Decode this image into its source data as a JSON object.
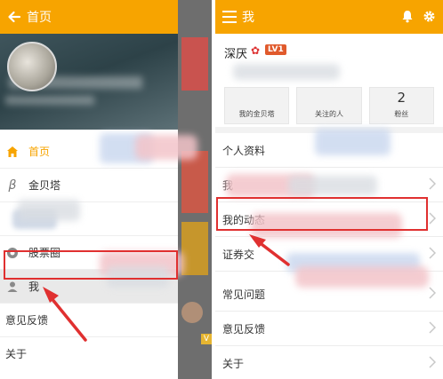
{
  "left_screen": {
    "topbar": {
      "title": "首页"
    },
    "drawer_menu": [
      {
        "label": "首页",
        "icon": "home-icon",
        "active": true
      },
      {
        "label": "金贝塔",
        "icon": "beta-icon"
      },
      {
        "label": "",
        "icon": ""
      },
      {
        "label": "股票圈",
        "icon": "circle-icon"
      },
      {
        "label": "我",
        "icon": "person-icon",
        "selected": true
      },
      {
        "label": "意见反馈",
        "icon": ""
      },
      {
        "label": "关于",
        "icon": ""
      }
    ],
    "underlay_badge": "V"
  },
  "right_screen": {
    "topbar": {
      "title": "我"
    },
    "user": {
      "name": "深厌",
      "level_badge": "LV1"
    },
    "stats": [
      {
        "value": "",
        "label": "我的金贝塔"
      },
      {
        "value": "",
        "label": "关注的人"
      },
      {
        "value": "2",
        "label": "粉丝"
      }
    ],
    "menu": [
      {
        "label": "个人资料"
      },
      {
        "label": "我"
      },
      {
        "label": "我的动态"
      },
      {
        "label": "证券交"
      },
      {
        "label": "常见问题"
      },
      {
        "label": "意见反馈"
      },
      {
        "label": "关于"
      }
    ]
  },
  "colors": {
    "brand": "#f7a400",
    "highlight_box": "#e03030",
    "level_badge": "#e05a2c"
  }
}
